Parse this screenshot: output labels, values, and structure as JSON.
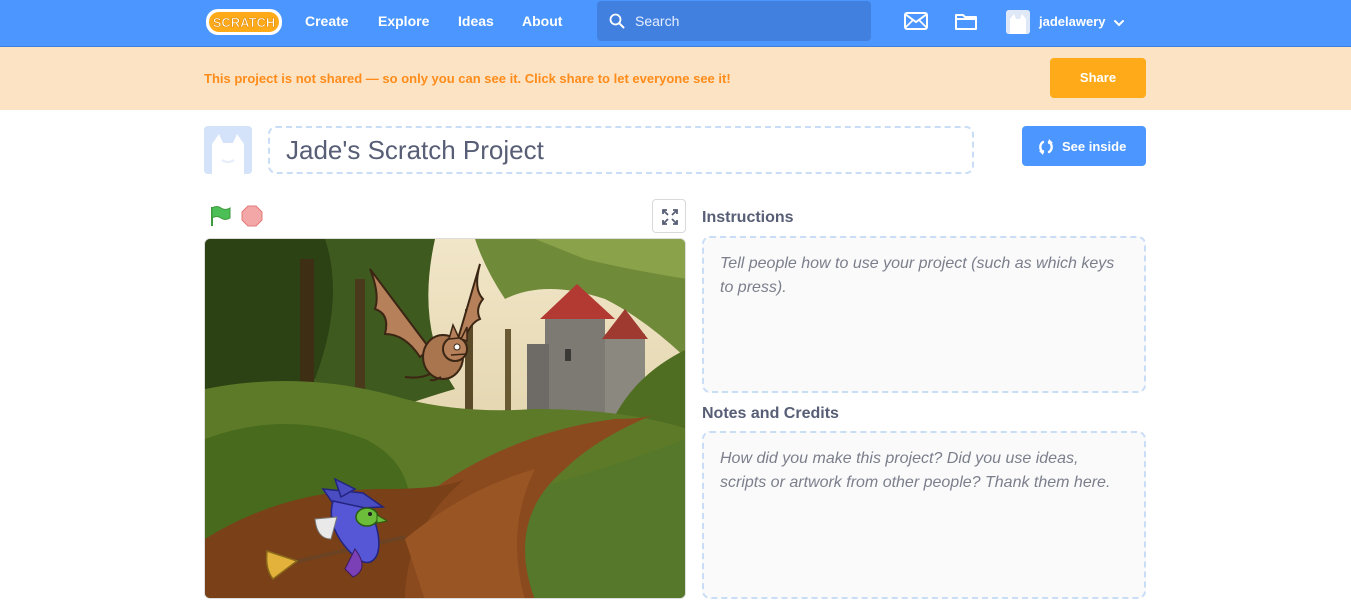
{
  "navbar": {
    "logo_text": "SCRATCH",
    "links": [
      "Create",
      "Explore",
      "Ideas",
      "About"
    ],
    "search_placeholder": "Search",
    "username": "jadelawery"
  },
  "banner": {
    "message": "This project is not shared — so only you can see it. Click share to let everyone see it!",
    "share_label": "Share"
  },
  "project": {
    "title": "Jade's Scratch Project",
    "see_inside_label": "See inside"
  },
  "instructions": {
    "label": "Instructions",
    "placeholder": "Tell people how to use your project (such as which keys to press)."
  },
  "notes": {
    "label": "Notes and Credits",
    "placeholder": "How did you make this project? Did you use ideas, scripts or artwork from other people? Thank them here."
  },
  "colors": {
    "brand_blue": "#4c97ff",
    "banner_bg": "#fbe3c4",
    "banner_text": "#ff8c1a",
    "share_orange": "#ffab19"
  }
}
